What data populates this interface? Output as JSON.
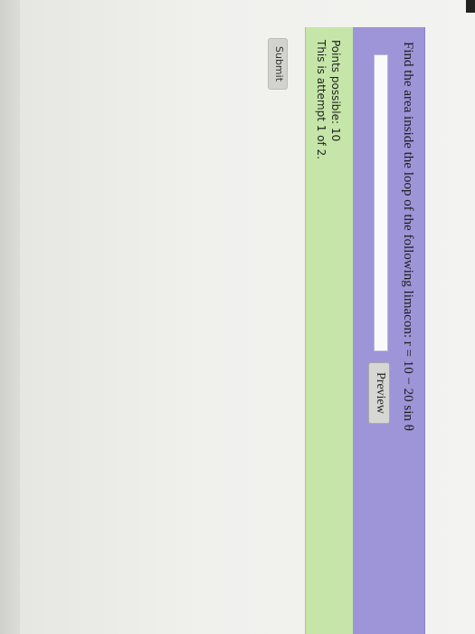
{
  "question": {
    "prompt": "Find the area inside the loop of the following limacon:",
    "equation": "r = 10 − 20 sin θ"
  },
  "answer": {
    "value": "",
    "placeholder": ""
  },
  "buttons": {
    "preview_label": "Preview",
    "submit_label": "Submit"
  },
  "status": {
    "points_possible": "Points possible: 10",
    "attempt": "This is attempt 1 of 2."
  },
  "colors": {
    "question_bg": "#9d95d8",
    "status_bg": "#c5e6a8"
  }
}
